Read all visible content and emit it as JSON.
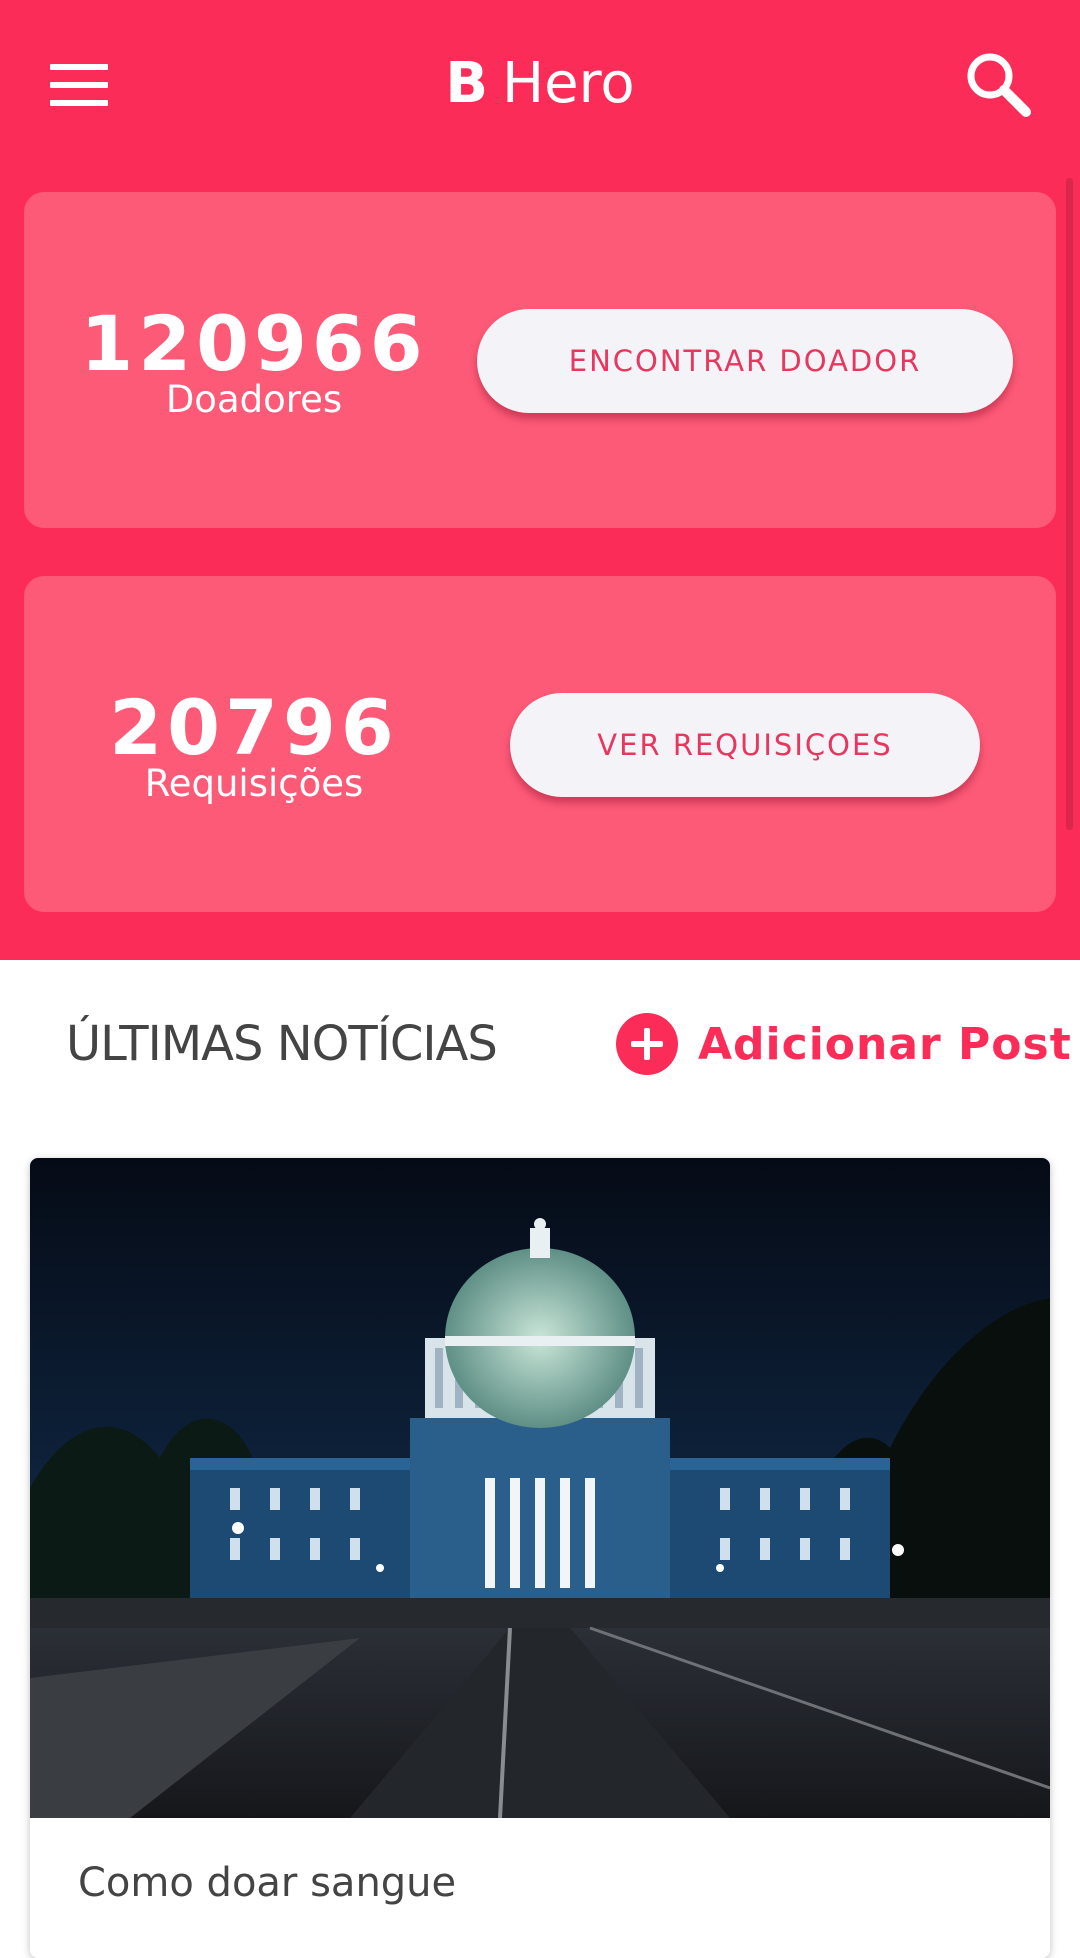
{
  "header": {
    "logo_letter": "B",
    "app_name": "Hero",
    "menu_icon": "hamburger-menu-icon",
    "search_icon": "magnifier-search-icon"
  },
  "stats": {
    "donors": {
      "count": "120966",
      "label": "Doadores",
      "button_label": "ENCONTRAR DOADOR"
    },
    "requests": {
      "count": "20796",
      "label": "Requisições",
      "button_label": "VER REQUISIÇOES"
    }
  },
  "news": {
    "section_title": "ÚLTIMAS NOTÍCIAS",
    "add_post_label": "Adicionar Post",
    "add_post_icon": "plus-circle-icon",
    "items": [
      {
        "image_subject": "capitol building at night",
        "title": "Como doar sangue"
      }
    ]
  },
  "colors": {
    "primary": "#fb2d58",
    "card": "#fd5a78",
    "button_bg": "#f4f4f8",
    "button_text": "#e8375f",
    "text_dark": "#444444"
  }
}
